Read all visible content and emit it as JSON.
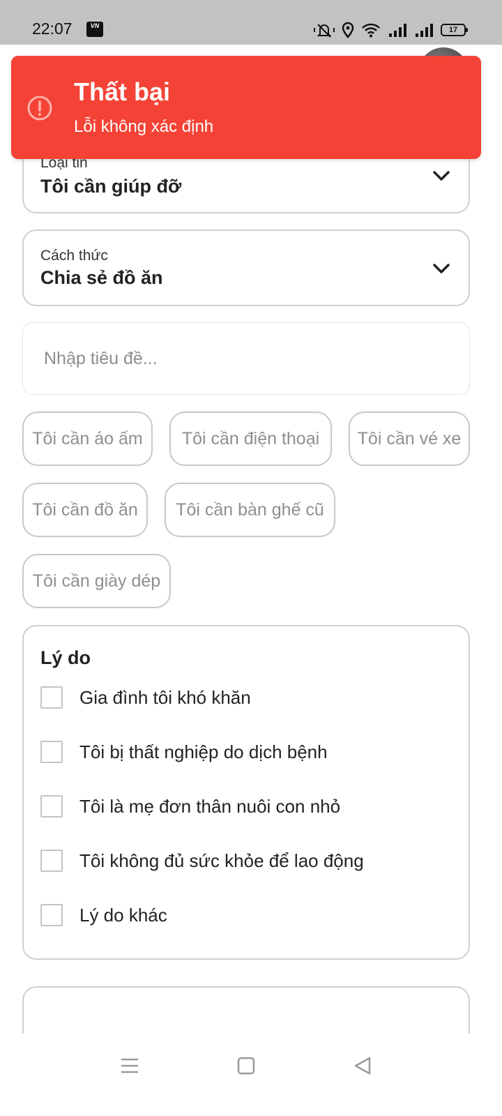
{
  "status_bar": {
    "time": "22:07",
    "carrier_label": "VN",
    "battery": "17",
    "icons": [
      "carrier-icon",
      "mute-icon",
      "location-icon",
      "wifi-icon",
      "signal-icon",
      "signal-icon",
      "battery-icon"
    ]
  },
  "toast": {
    "title": "Thất bại",
    "message": "Lỗi không xác định",
    "color": "#f44336",
    "icon": "alert-circle-icon"
  },
  "form": {
    "post_type": {
      "label": "Loại tin",
      "value": "Tôi cần giúp đỡ"
    },
    "method": {
      "label": "Cách thức",
      "value": "Chia sẻ đồ ăn"
    },
    "title_input": {
      "placeholder": "Nhập tiêu đề...",
      "value": ""
    },
    "suggestions": [
      "Tôi cần áo ấm",
      "Tôi cần điện thoại",
      "Tôi cần vé xe",
      "Tôi cần đồ ăn",
      "Tôi cần bàn ghế cũ",
      "Tôi cần giày dép"
    ],
    "reasons": {
      "title": "Lý do",
      "options": [
        {
          "label": "Gia đình tôi khó khăn",
          "checked": false
        },
        {
          "label": "Tôi bị thất nghiệp do dịch bệnh",
          "checked": false
        },
        {
          "label": "Tôi là mẹ đơn thân nuôi con nhỏ",
          "checked": false
        },
        {
          "label": "Tôi không đủ sức khỏe để lao động",
          "checked": false
        },
        {
          "label": "Lý do khác",
          "checked": false
        }
      ]
    }
  },
  "nav_bar": {
    "icons": [
      "menu-icon",
      "home-square-icon",
      "back-triangle-icon"
    ]
  }
}
